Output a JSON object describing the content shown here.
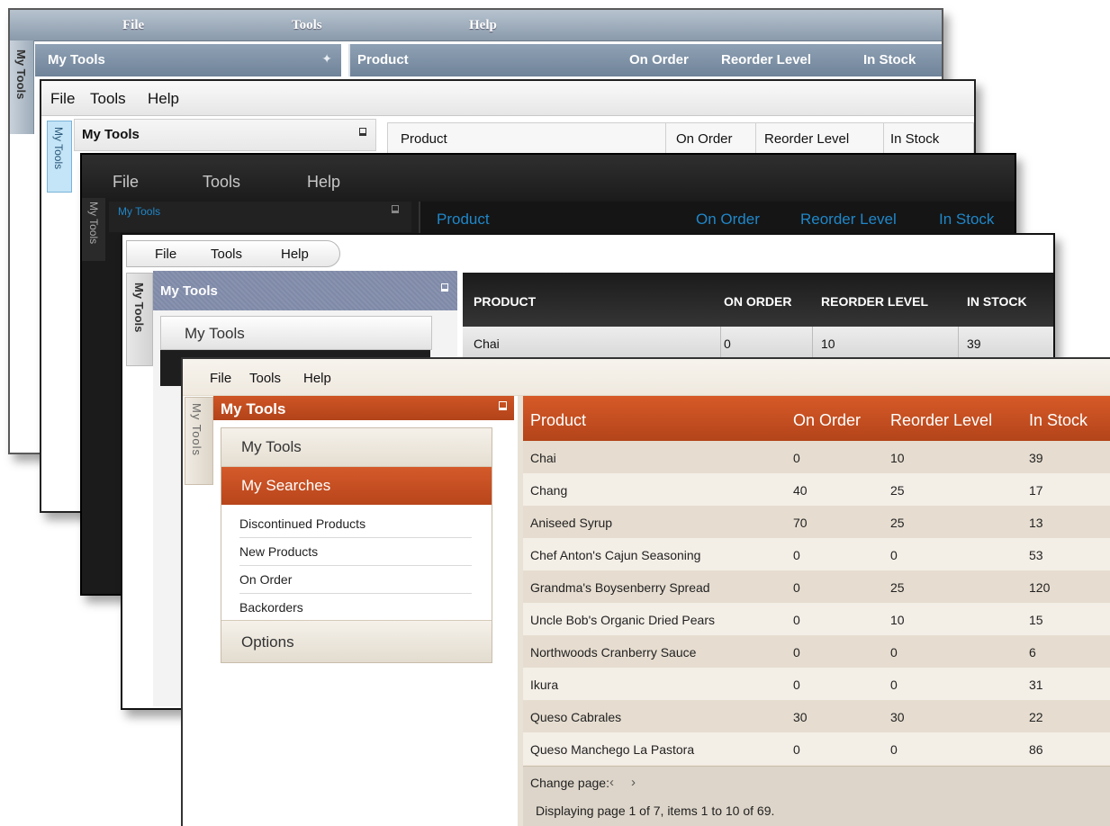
{
  "menu": {
    "file": "File",
    "tools": "Tools",
    "help": "Help"
  },
  "panel": {
    "tab_label": "My Tools",
    "title": "My Tools"
  },
  "columns": {
    "product": "Product",
    "on_order": "On Order",
    "reorder_level": "Reorder Level",
    "in_stock": "In Stock"
  },
  "columns_upper": {
    "product": "PRODUCT",
    "on_order": "ON ORDER",
    "reorder_level": "REORDER LEVEL",
    "in_stock": "IN STOCK"
  },
  "nav": {
    "my_tools": "My Tools",
    "my_searches": "My Searches",
    "searches": [
      "Discontinued Products",
      "New Products",
      "On Order",
      "Backorders"
    ],
    "options": "Options"
  },
  "rows": [
    {
      "product": "Chai",
      "on_order": "0",
      "reorder_level": "10",
      "in_stock": "39"
    },
    {
      "product": "Chang",
      "on_order": "40",
      "reorder_level": "25",
      "in_stock": "17"
    },
    {
      "product": "Aniseed Syrup",
      "on_order": "70",
      "reorder_level": "25",
      "in_stock": "13"
    },
    {
      "product": "Chef Anton's Cajun Seasoning",
      "on_order": "0",
      "reorder_level": "0",
      "in_stock": "53"
    },
    {
      "product": "Grandma's Boysenberry Spread",
      "on_order": "0",
      "reorder_level": "25",
      "in_stock": "120"
    },
    {
      "product": "Uncle Bob's Organic Dried Pears",
      "on_order": "0",
      "reorder_level": "10",
      "in_stock": "15"
    },
    {
      "product": "Northwoods Cranberry Sauce",
      "on_order": "0",
      "reorder_level": "0",
      "in_stock": "6"
    },
    {
      "product": "Ikura",
      "on_order": "0",
      "reorder_level": "0",
      "in_stock": "31"
    },
    {
      "product": "Queso Cabrales",
      "on_order": "30",
      "reorder_level": "30",
      "in_stock": "22"
    },
    {
      "product": "Queso Manchego La Pastora",
      "on_order": "0",
      "reorder_level": "0",
      "in_stock": "86"
    }
  ],
  "pager": {
    "label": "Change page:",
    "prev": "‹",
    "next": "›",
    "info": "Displaying page 1 of 7, items 1 to 10 of 69."
  },
  "theme": {
    "accent": "#c14e1f",
    "dark": "#1b1b1b",
    "steel": "#7d90a4"
  }
}
